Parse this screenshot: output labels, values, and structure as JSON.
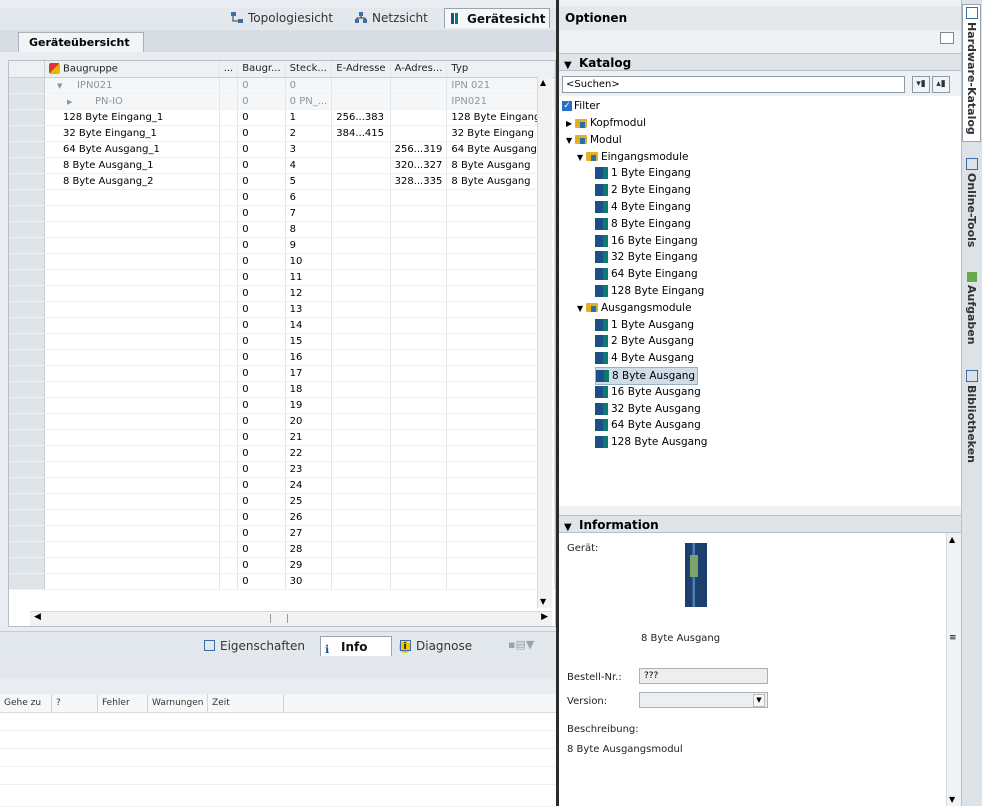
{
  "view_tabs": {
    "topology": "Topologiesicht",
    "network": "Netzsicht",
    "device": "Gerätesicht"
  },
  "overview_tab": "Geräteübersicht",
  "table": {
    "headers": [
      "Baugruppe",
      "...",
      "Baugr...",
      "Steck...",
      "E-Adresse",
      "A-Adres...",
      "Typ"
    ],
    "rows": [
      {
        "name": "IPN021",
        "rack": "0",
        "slot": "0",
        "in": "",
        "out": "",
        "type": "IPN 021",
        "grey": true,
        "expand": "down"
      },
      {
        "name": "PN-IO",
        "rack": "0",
        "slot": "0 PN_...",
        "in": "",
        "out": "",
        "type": "IPN021",
        "grey": true,
        "expand": "right"
      },
      {
        "name": "128 Byte Eingang_1",
        "rack": "0",
        "slot": "1",
        "in": "256...383",
        "out": "",
        "type": "128 Byte Eingang"
      },
      {
        "name": "32 Byte Eingang_1",
        "rack": "0",
        "slot": "2",
        "in": "384...415",
        "out": "",
        "type": "32 Byte Eingang"
      },
      {
        "name": "64 Byte Ausgang_1",
        "rack": "0",
        "slot": "3",
        "in": "",
        "out": "256...319",
        "type": "64 Byte Ausgang"
      },
      {
        "name": "8 Byte Ausgang_1",
        "rack": "0",
        "slot": "4",
        "in": "",
        "out": "320...327",
        "type": "8 Byte Ausgang"
      },
      {
        "name": "8 Byte Ausgang_2",
        "rack": "0",
        "slot": "5",
        "in": "",
        "out": "328...335",
        "type": "8 Byte Ausgang"
      },
      {
        "name": "",
        "rack": "0",
        "slot": "6",
        "in": "",
        "out": "",
        "type": ""
      },
      {
        "name": "",
        "rack": "0",
        "slot": "7",
        "in": "",
        "out": "",
        "type": ""
      },
      {
        "name": "",
        "rack": "0",
        "slot": "8",
        "in": "",
        "out": "",
        "type": ""
      },
      {
        "name": "",
        "rack": "0",
        "slot": "9",
        "in": "",
        "out": "",
        "type": ""
      },
      {
        "name": "",
        "rack": "0",
        "slot": "10",
        "in": "",
        "out": "",
        "type": ""
      },
      {
        "name": "",
        "rack": "0",
        "slot": "11",
        "in": "",
        "out": "",
        "type": ""
      },
      {
        "name": "",
        "rack": "0",
        "slot": "12",
        "in": "",
        "out": "",
        "type": ""
      },
      {
        "name": "",
        "rack": "0",
        "slot": "13",
        "in": "",
        "out": "",
        "type": ""
      },
      {
        "name": "",
        "rack": "0",
        "slot": "14",
        "in": "",
        "out": "",
        "type": ""
      },
      {
        "name": "",
        "rack": "0",
        "slot": "15",
        "in": "",
        "out": "",
        "type": ""
      },
      {
        "name": "",
        "rack": "0",
        "slot": "16",
        "in": "",
        "out": "",
        "type": ""
      },
      {
        "name": "",
        "rack": "0",
        "slot": "17",
        "in": "",
        "out": "",
        "type": ""
      },
      {
        "name": "",
        "rack": "0",
        "slot": "18",
        "in": "",
        "out": "",
        "type": ""
      },
      {
        "name": "",
        "rack": "0",
        "slot": "19",
        "in": "",
        "out": "",
        "type": ""
      },
      {
        "name": "",
        "rack": "0",
        "slot": "20",
        "in": "",
        "out": "",
        "type": ""
      },
      {
        "name": "",
        "rack": "0",
        "slot": "21",
        "in": "",
        "out": "",
        "type": ""
      },
      {
        "name": "",
        "rack": "0",
        "slot": "22",
        "in": "",
        "out": "",
        "type": ""
      },
      {
        "name": "",
        "rack": "0",
        "slot": "23",
        "in": "",
        "out": "",
        "type": ""
      },
      {
        "name": "",
        "rack": "0",
        "slot": "24",
        "in": "",
        "out": "",
        "type": ""
      },
      {
        "name": "",
        "rack": "0",
        "slot": "25",
        "in": "",
        "out": "",
        "type": ""
      },
      {
        "name": "",
        "rack": "0",
        "slot": "26",
        "in": "",
        "out": "",
        "type": ""
      },
      {
        "name": "",
        "rack": "0",
        "slot": "27",
        "in": "",
        "out": "",
        "type": ""
      },
      {
        "name": "",
        "rack": "0",
        "slot": "28",
        "in": "",
        "out": "",
        "type": ""
      },
      {
        "name": "",
        "rack": "0",
        "slot": "29",
        "in": "",
        "out": "",
        "type": ""
      },
      {
        "name": "",
        "rack": "0",
        "slot": "30",
        "in": "",
        "out": "",
        "type": ""
      }
    ]
  },
  "bottom_tabs": {
    "properties": "Eigenschaften",
    "info": "Info",
    "diagnose": "Diagnose"
  },
  "info_columns": [
    "Gehe zu",
    "?",
    "Fehler",
    "Warnungen",
    "Zeit"
  ],
  "options": {
    "title": "Optionen",
    "catalog_title": "Katalog",
    "search_placeholder": "<Suchen>",
    "filter_label": "Filter",
    "tree": [
      {
        "label": "Kopfmodul",
        "kind": "folder",
        "level": 0,
        "expand": "right"
      },
      {
        "label": "Modul",
        "kind": "folder",
        "level": 0,
        "expand": "down"
      },
      {
        "label": "Eingangsmodule",
        "kind": "folder",
        "level": 1,
        "expand": "down"
      },
      {
        "label": "1 Byte Eingang",
        "kind": "module",
        "level": 2
      },
      {
        "label": "2 Byte Eingang",
        "kind": "module",
        "level": 2
      },
      {
        "label": "4 Byte Eingang",
        "kind": "module",
        "level": 2
      },
      {
        "label": "8 Byte Eingang",
        "kind": "module",
        "level": 2
      },
      {
        "label": "16 Byte Eingang",
        "kind": "module",
        "level": 2
      },
      {
        "label": "32 Byte Eingang",
        "kind": "module",
        "level": 2
      },
      {
        "label": "64 Byte Eingang",
        "kind": "module",
        "level": 2
      },
      {
        "label": "128 Byte Eingang",
        "kind": "module",
        "level": 2
      },
      {
        "label": "Ausgangsmodule",
        "kind": "folder",
        "level": 1,
        "expand": "down"
      },
      {
        "label": "1 Byte Ausgang",
        "kind": "module",
        "level": 2
      },
      {
        "label": "2 Byte Ausgang",
        "kind": "module",
        "level": 2
      },
      {
        "label": "4 Byte Ausgang",
        "kind": "module",
        "level": 2
      },
      {
        "label": "8 Byte Ausgang",
        "kind": "module",
        "level": 2,
        "selected": true
      },
      {
        "label": "16 Byte Ausgang",
        "kind": "module",
        "level": 2
      },
      {
        "label": "32 Byte Ausgang",
        "kind": "module",
        "level": 2
      },
      {
        "label": "64 Byte Ausgang",
        "kind": "module",
        "level": 2
      },
      {
        "label": "128 Byte Ausgang",
        "kind": "module",
        "level": 2
      }
    ],
    "information_title": "Information",
    "device_label": "Gerät:",
    "device_name": "8 Byte Ausgang",
    "order_label": "Bestell-Nr.:",
    "order_value": "???",
    "version_label": "Version:",
    "version_value": "",
    "description_label": "Beschreibung:",
    "description_value": "8 Byte Ausgangsmodul"
  },
  "side_tabs": [
    "Hardware-Katalog",
    "Online-Tools",
    "Aufgaben",
    "Bibliotheken"
  ]
}
